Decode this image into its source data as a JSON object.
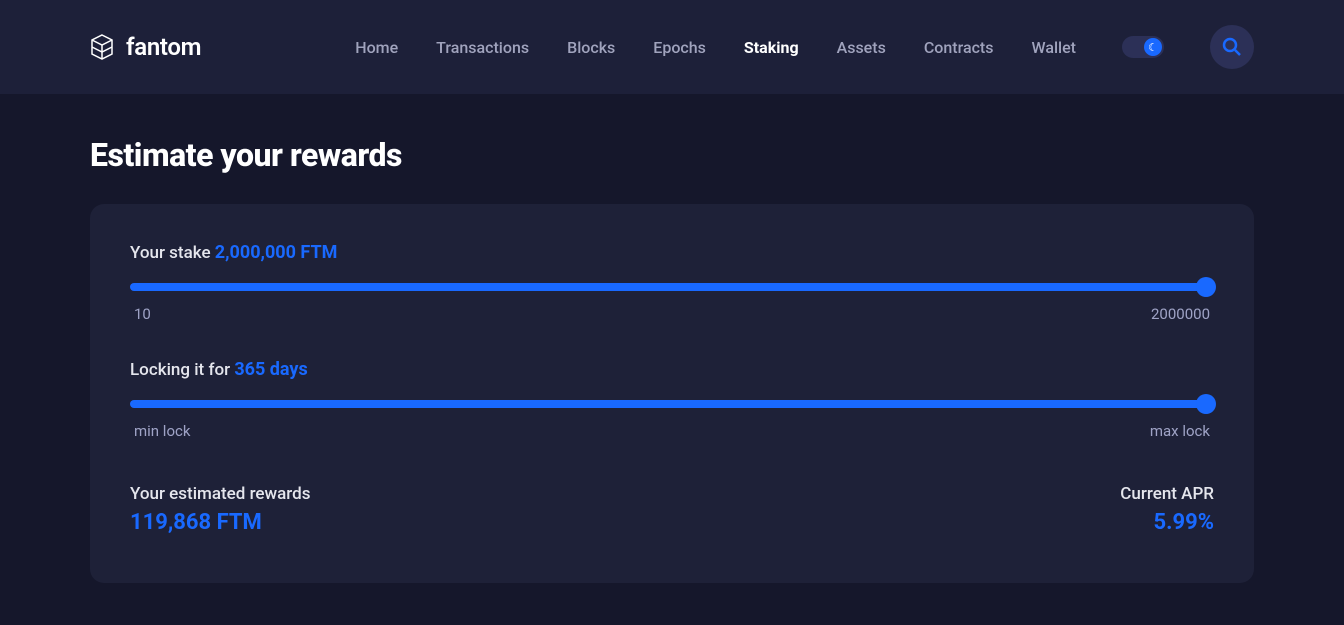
{
  "logo": {
    "text": "fantom"
  },
  "nav": {
    "home": "Home",
    "transactions": "Transactions",
    "blocks": "Blocks",
    "epochs": "Epochs",
    "staking": "Staking",
    "assets": "Assets",
    "contracts": "Contracts",
    "wallet": "Wallet"
  },
  "page": {
    "title": "Estimate your rewards"
  },
  "stake": {
    "label": "Your stake",
    "value": "2,000,000 FTM",
    "min": "10",
    "max": "2000000"
  },
  "lock": {
    "label": "Locking it for",
    "value": "365 days",
    "min": "min lock",
    "max": "max lock"
  },
  "rewards": {
    "label": "Your estimated rewards",
    "value": "119,868 FTM"
  },
  "apr": {
    "label": "Current APR",
    "value": "5.99%"
  }
}
